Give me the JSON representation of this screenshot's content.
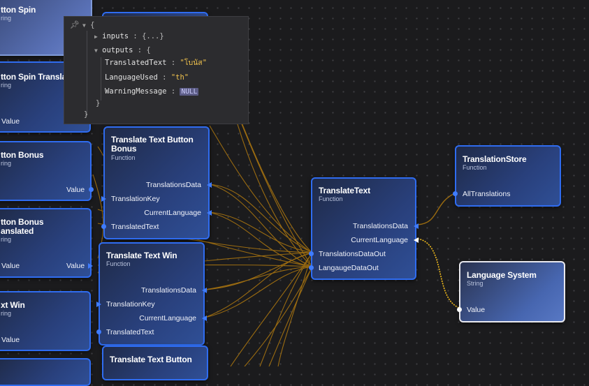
{
  "inspector": {
    "open_brace": "{",
    "inputs_key": "inputs",
    "inputs_collapsed": "{...}",
    "outputs_key": "outputs",
    "outputs_open": "{",
    "fields": [
      {
        "key": "TranslatedText",
        "value": "\"โบนัส\"",
        "kind": "string"
      },
      {
        "key": "LanguageUsed",
        "value": "\"th\"",
        "kind": "string"
      },
      {
        "key": "WarningMessage",
        "value": "NULL",
        "kind": "null"
      }
    ],
    "close_inner": "}",
    "close_outer": "}"
  },
  "nodes": {
    "button_spin": {
      "title": "tton Spin",
      "subtitle": "ring"
    },
    "button_spin_translated": {
      "title": "tton Spin Transla",
      "subtitle": "ring",
      "port_value": "Value"
    },
    "button_bonus": {
      "title": "tton Bonus",
      "subtitle": "ring",
      "port_value": "Value"
    },
    "button_bonus_translated": {
      "title_1": "tton Bonus",
      "title_2": "anslated",
      "subtitle": "ring",
      "port_value_left": "Value",
      "port_value": "Value"
    },
    "text_win": {
      "title": "xt Win",
      "subtitle": "ring",
      "port_value": "Value"
    },
    "translate_bonus": {
      "title_1": "Translate Text Button",
      "title_2": "Bonus",
      "subtitle": "Function",
      "ports": [
        "TranslationsData",
        "TranslationKey",
        "CurrentLanguage",
        "TranslatedText"
      ]
    },
    "translate_win": {
      "title": "Translate Text Win",
      "subtitle": "Function",
      "ports": [
        "TranslationsData",
        "TranslationKey",
        "CurrentLanguage",
        "TranslatedText"
      ]
    },
    "translate_button_bottom": {
      "title": "Translate Text Button"
    },
    "translate_text": {
      "title": "TranslateText",
      "subtitle": "Function",
      "ports": [
        "TranslationsData",
        "CurrentLanguage",
        "TranslationsDataOut",
        "LangaugeDataOut"
      ]
    },
    "translation_store": {
      "title": "TranslationStore",
      "subtitle": "Function",
      "ports": [
        "AllTranslations"
      ]
    },
    "language_system": {
      "title": "Language System",
      "subtitle": "String",
      "ports": [
        "Value"
      ]
    }
  },
  "colors": {
    "background": "#1b1b1d",
    "node_border": "#2f6cf0",
    "port": "#3f7cff",
    "wire": "#b07a10",
    "wire_active": "#f0b820",
    "string_value": "#f0c24d"
  }
}
